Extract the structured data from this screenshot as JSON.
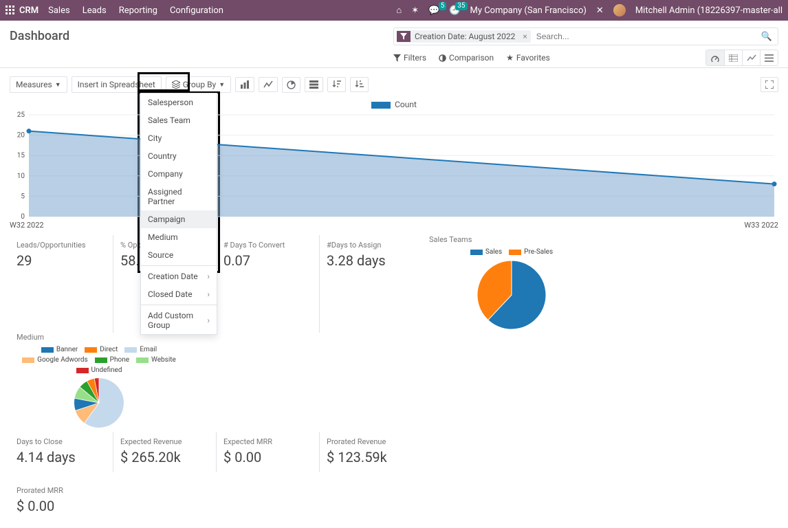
{
  "topbar": {
    "brand": "CRM",
    "menus": [
      "Sales",
      "Leads",
      "Reporting",
      "Configuration"
    ],
    "msg_badge": "5",
    "clock_badge": "35",
    "company": "My Company (San Francisco)",
    "user": "Mitchell Admin (18226397-master-all"
  },
  "header": {
    "title": "Dashboard",
    "facet_label": "Creation Date: August 2022",
    "search_placeholder": "Search...",
    "filters_label": "Filters",
    "comparison_label": "Comparison",
    "favorites_label": "Favorites"
  },
  "toolbar": {
    "measures": "Measures",
    "insert": "Insert in Spreadsheet",
    "groupby": "Group By"
  },
  "dropdown": {
    "items": [
      "Salesperson",
      "Sales Team",
      "City",
      "Country",
      "Company",
      "Assigned Partner",
      "Campaign",
      "Medium",
      "Source"
    ],
    "hover_index": 6,
    "dates": [
      "Creation Date",
      "Closed Date"
    ],
    "custom": "Add Custom Group"
  },
  "chart_data": {
    "type": "line",
    "title": "",
    "legend": "Count",
    "x": [
      "W32 2022",
      "W33 2022"
    ],
    "y": [
      21,
      8
    ],
    "ylim": [
      0,
      25
    ],
    "yticks": [
      0,
      5,
      10,
      15,
      20,
      25
    ]
  },
  "kpis_row1": [
    {
      "label": "Leads/Opportunities",
      "value": "29"
    },
    {
      "label": "% Opp",
      "value": "58."
    },
    {
      "label": "# Days To Convert",
      "value": "0.07"
    },
    {
      "label": "#Days to Assign",
      "value": "3.28 days"
    }
  ],
  "kpis_row2": [
    {
      "label": "Days to Close",
      "value": "4.14 days"
    },
    {
      "label": "Expected Revenue",
      "value": "$ 265.20k"
    },
    {
      "label": "Expected MRR",
      "value": "$ 0.00"
    },
    {
      "label": "Prorated Revenue",
      "value": "$ 123.59k"
    }
  ],
  "kpis_row3": [
    {
      "label": "Prorated MRR",
      "value": "$ 0.00"
    }
  ],
  "panel1": {
    "title": "Sales Teams",
    "legend": [
      {
        "name": "Sales",
        "color": "#1f77b4"
      },
      {
        "name": "Pre-Sales",
        "color": "#ff7f0e"
      }
    ],
    "pie": [
      {
        "v": 62,
        "c": "#1f77b4"
      },
      {
        "v": 38,
        "c": "#ff7f0e"
      }
    ]
  },
  "panel2": {
    "title": "Medium",
    "legend": [
      {
        "name": "Banner",
        "color": "#1f77b4"
      },
      {
        "name": "Direct",
        "color": "#ff7f0e"
      },
      {
        "name": "Email",
        "color": "#c5d9ed"
      },
      {
        "name": "Google Adwords",
        "color": "#ffbb78"
      },
      {
        "name": "Phone",
        "color": "#2ca02c"
      },
      {
        "name": "Website",
        "color": "#98df8a"
      },
      {
        "name": "Undefined",
        "color": "#d62728"
      }
    ],
    "pie": [
      {
        "v": 60,
        "c": "#c5d9ed"
      },
      {
        "v": 10,
        "c": "#ffbb78"
      },
      {
        "v": 8,
        "c": "#1f77b4"
      },
      {
        "v": 8,
        "c": "#98df8a"
      },
      {
        "v": 6,
        "c": "#2ca02c"
      },
      {
        "v": 5,
        "c": "#ff7f0e"
      },
      {
        "v": 3,
        "c": "#d62728"
      }
    ]
  }
}
